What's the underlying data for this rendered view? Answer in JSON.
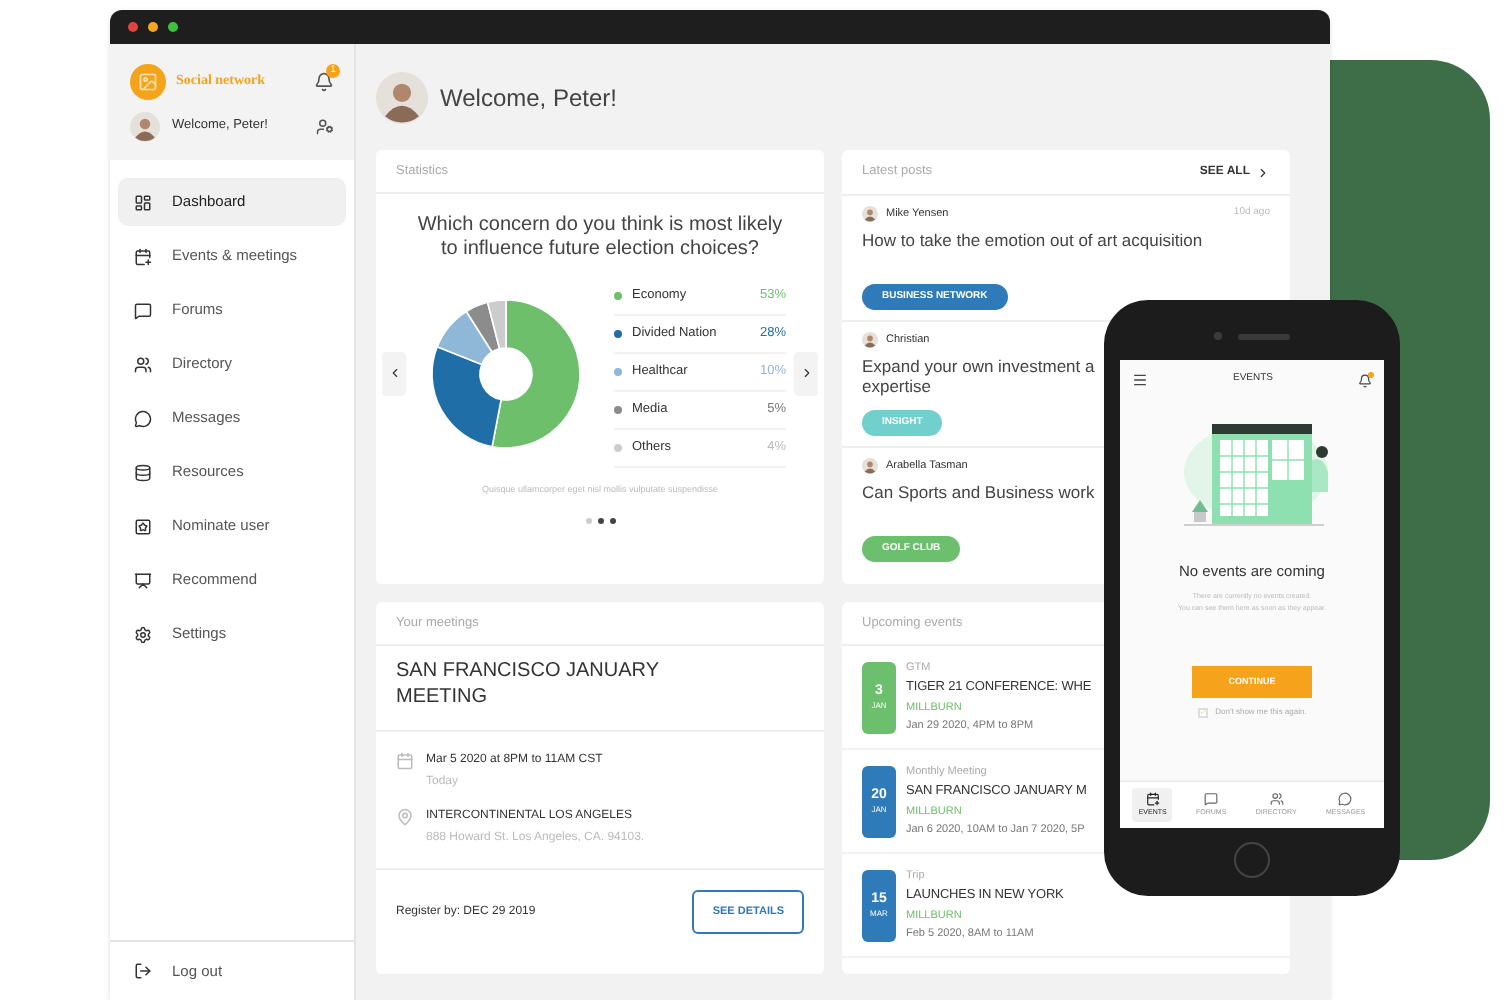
{
  "sidebar": {
    "brand": "Social network",
    "notifications": "1",
    "user": "Welcome, Peter!",
    "items": [
      {
        "label": "Dashboard",
        "selected": true
      },
      {
        "label": "Events & meetings",
        "selected": false
      },
      {
        "label": "Forums",
        "selected": false
      },
      {
        "label": "Directory",
        "selected": false
      },
      {
        "label": "Messages",
        "selected": false
      },
      {
        "label": "Resources",
        "selected": false
      },
      {
        "label": "Nominate user",
        "selected": false
      },
      {
        "label": "Recommend",
        "selected": false
      },
      {
        "label": "Settings",
        "selected": false
      }
    ],
    "logout": "Log out"
  },
  "header": {
    "welcome": "Welcome, Peter!"
  },
  "statistics": {
    "title": "Statistics",
    "question": "Which concern do you think is most likely to influence future election choices?",
    "legend": [
      {
        "value": "53%",
        "color": "#6dbf6b"
      },
      {
        "value": "28%",
        "color": "#1f6ea8"
      },
      {
        "value": "10%",
        "color": "#8fb7d8"
      },
      {
        "value": "5%",
        "color": "#8c8c8c"
      },
      {
        "value": "4%",
        "color": "#cccccc"
      }
    ],
    "chart_data": {
      "type": "donut",
      "categories": [
        "Economy",
        "Divided Nation",
        "Healthcar",
        "Media",
        "Others"
      ],
      "values": [
        53,
        28,
        10,
        5,
        4
      ]
    },
    "caption": "Quisque ullamcorper eget nisl mollis vulputate suspendisse",
    "pages": [
      {
        "selected": false
      },
      {
        "selected": true
      },
      {
        "selected": true
      }
    ]
  },
  "latest_posts": {
    "title": "Latest posts",
    "see_all": "SEE ALL",
    "posts": [
      {
        "author": "Mike Yensen",
        "time": "10d ago",
        "title_lines": [
          "How to take the emotion out of art acquisition"
        ],
        "tag": "BUSINESS NETWORK",
        "color": "#2f7ab8"
      },
      {
        "author": "Christian",
        "title_lines": [
          "Expand your own investment a",
          "expertise"
        ],
        "tag": "INSIGHT",
        "color": "#72d0cc"
      },
      {
        "author": "Arabella Tasman",
        "title_lines": [
          "Can Sports and Business work"
        ],
        "tag": "GOLF CLUB",
        "color": "#6cbf6c"
      }
    ]
  },
  "meetings": {
    "title": "Your meetings",
    "name": "SAN FRANCISCO JANUARY MEETING",
    "date": "Mar 5 2020 at 8PM to 11AM CST",
    "when": "Today",
    "venue": "INTERCONTINENTAL LOS ANGELES",
    "address": "888 Howard St. Los Angeles, CA. 94103.",
    "register": "Register by: DEC 29 2019",
    "button": "SEE DETAILS"
  },
  "upcoming": {
    "title": "Upcoming events",
    "events": [
      {
        "day": "3",
        "month": "JAN",
        "color": "#6cbf6c",
        "category": "GTM",
        "title": "TIGER 21 CONFERENCE: WHE",
        "location": "MILLBURN",
        "time": "Jan 29 2020, 4PM to 8PM"
      },
      {
        "day": "20",
        "month": "JAN",
        "color": "#2f7ab8",
        "category": "Monthly Meeting",
        "title": "SAN FRANCISCO JANUARY M",
        "location": "MILLBURN",
        "time": "Jan 6 2020, 10AM to Jan 7 2020, 5P"
      },
      {
        "day": "15",
        "month": "MAR",
        "color": "#2f7ab8",
        "category": "Trip",
        "title": "LAUNCHES IN NEW YORK",
        "location": "MILLBURN",
        "time": "Feb 5 2020, 8AM to 11AM"
      }
    ]
  },
  "phone": {
    "title": "EVENTS",
    "empty_title": "No events are coming",
    "empty_lines": [
      "There are currently no events created.",
      "You can see them here as soon as they appear."
    ],
    "button": "CONTINUE",
    "dont_show": {
      "label": "Don't show me this again.",
      "checked": true
    },
    "nav": [
      {
        "label": "EVENTS",
        "selected": true
      },
      {
        "label": "FORUMS",
        "selected": false
      },
      {
        "label": "DIRECTORY",
        "selected": false
      },
      {
        "label": "MESSAGES",
        "selected": false
      }
    ]
  }
}
